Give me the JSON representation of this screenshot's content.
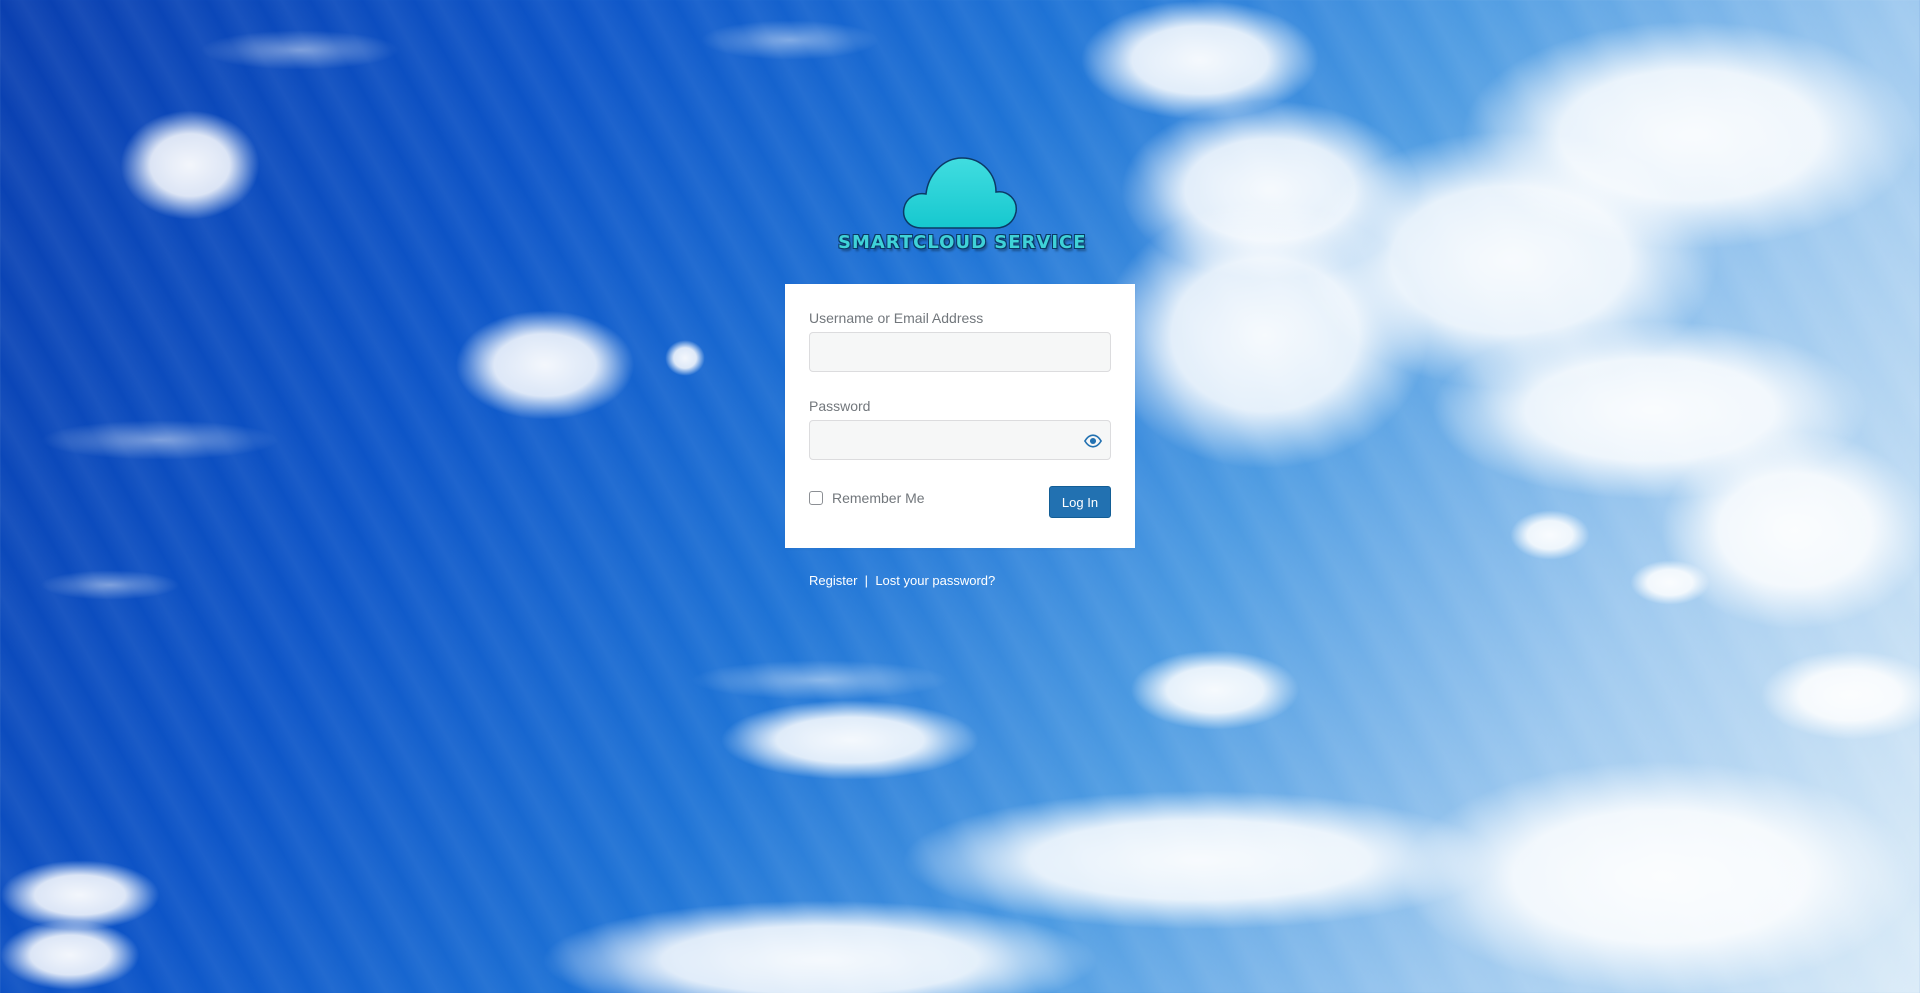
{
  "branding": {
    "logo_text": "SMARTCLOUD SERVICE",
    "logo_icon": "cloud-icon",
    "logo_color": "#3fd2d8"
  },
  "login_form": {
    "username_label": "Username or Email Address",
    "username_value": "",
    "password_label": "Password",
    "password_value": "",
    "show_password_icon": "eye-icon",
    "remember_label": "Remember Me",
    "remember_checked": false,
    "submit_label": "Log In"
  },
  "nav": {
    "register_label": "Register",
    "separator": "|",
    "lost_password_label": "Lost your password?"
  },
  "colors": {
    "primary_button": "#2271b1",
    "label_text": "#72777c"
  }
}
